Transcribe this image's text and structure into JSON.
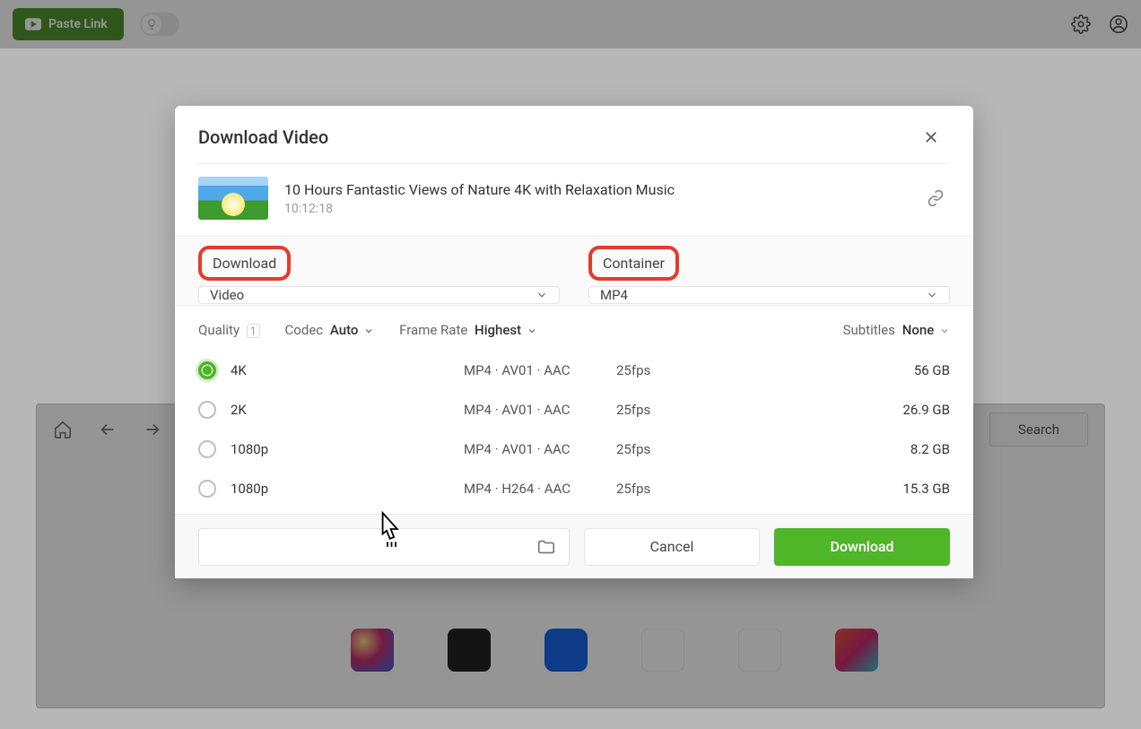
{
  "toolbar": {
    "paste_link_label": "Paste Link"
  },
  "browser": {
    "search_label": "Search"
  },
  "modal": {
    "title": "Download Video",
    "video": {
      "title": "10 Hours Fantastic Views of Nature 4K with Relaxation Music",
      "duration": "10:12:18"
    },
    "download_label": "Download",
    "container_label": "Container",
    "download_select_value": "Video",
    "container_select_value": "MP4",
    "filters": {
      "quality_label": "Quality",
      "quality_badge": "1",
      "codec_label": "Codec",
      "codec_value": "Auto",
      "framerate_label": "Frame Rate",
      "framerate_value": "Highest",
      "subtitles_label": "Subtitles",
      "subtitles_value": "None"
    },
    "quality_rows": [
      {
        "res": "4K",
        "codec": "MP4 · AV01 · AAC",
        "fps": "25fps",
        "size": "56 GB",
        "selected": true
      },
      {
        "res": "2K",
        "codec": "MP4 · AV01 · AAC",
        "fps": "25fps",
        "size": "26.9 GB",
        "selected": false
      },
      {
        "res": "1080p",
        "codec": "MP4 · AV01 · AAC",
        "fps": "25fps",
        "size": "8.2 GB",
        "selected": false
      },
      {
        "res": "1080p",
        "codec": "MP4 · H264 · AAC",
        "fps": "25fps",
        "size": "15.3 GB",
        "selected": false
      }
    ],
    "cancel_label": "Cancel",
    "download_button_label": "Download"
  }
}
